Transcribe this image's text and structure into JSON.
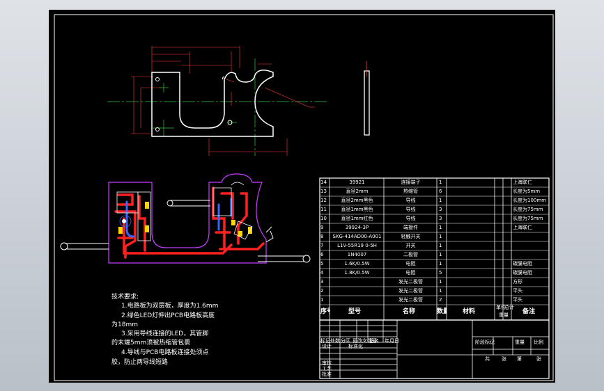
{
  "tech_notes": {
    "title": "技术要求:",
    "lines": [
      "1.电路板为双层板，厚度为1.6mm",
      "2.绿色LED灯伸出PCB电路板高度",
      "为18mm",
      "3.采用导线连接的LED，其管脚",
      "的末端5mm须被热缩管包裹",
      "4.导线与PCB电路板连接处须点",
      "胶，防止两导线短路"
    ]
  },
  "bom": {
    "header": {
      "seq": "序号",
      "code": "型号",
      "name": "名称",
      "qty": "数量",
      "material": "材料",
      "unit_weight": "单件",
      "total_weight": "总计",
      "weight": "重量",
      "remark": "备注"
    },
    "rows": [
      {
        "seq": "14",
        "code": "39921",
        "name": "连接端子",
        "qty": "1",
        "remark": "上海联仁"
      },
      {
        "seq": "13",
        "code": "直径2mm",
        "name": "热缩管",
        "qty": "6",
        "remark": "长度为5mm"
      },
      {
        "seq": "12",
        "code": "直径2mm黑色",
        "name": "导线",
        "qty": "1",
        "remark": "长度为100mm"
      },
      {
        "seq": "11",
        "code": "直径1mm黑色",
        "name": "导线",
        "qty": "3",
        "remark": "长度为75mm"
      },
      {
        "seq": "10",
        "code": "直径1mm红色",
        "name": "导线",
        "qty": "3",
        "remark": "长度为75mm"
      },
      {
        "seq": "9",
        "code": "39924-3P",
        "name": "端接件",
        "qty": "1",
        "remark": "上海联仁"
      },
      {
        "seq": "8",
        "code": "SKG-414AD00-A001",
        "name": "轻触开关",
        "qty": "1",
        "remark": ""
      },
      {
        "seq": "7",
        "code": "L1V-55R19 0-5H",
        "name": "开关",
        "qty": "1",
        "remark": ""
      },
      {
        "seq": "6",
        "code": "1N4007",
        "name": "二极管",
        "qty": "1",
        "remark": ""
      },
      {
        "seq": "5",
        "code": "1.6K/0.5W",
        "name": "电阻",
        "qty": "1",
        "remark": "碳膜电阻"
      },
      {
        "seq": "4",
        "code": "1.8K/0.5W",
        "name": "电阻",
        "qty": "5",
        "remark": "碳膜电阻"
      },
      {
        "seq": "3",
        "code": "",
        "name": "发光二极管",
        "qty": "1",
        "remark": "方形"
      },
      {
        "seq": "2",
        "code": "",
        "name": "发光二极管",
        "qty": "1",
        "remark": "平头"
      },
      {
        "seq": "1",
        "code": "",
        "name": "发光二极管",
        "qty": "2",
        "remark": "平头"
      }
    ]
  },
  "title_block": {
    "left_labels": [
      "标记",
      "处数",
      "分区",
      "更改文件号",
      "签名",
      "年月日"
    ],
    "role_labels": [
      "设计",
      "审核",
      "工艺",
      "批准"
    ],
    "standardization": "标准化",
    "stage_labels": [
      "阶段标记",
      "重量",
      "比例"
    ],
    "sheet_labels": [
      "共",
      "张",
      "第",
      "张"
    ]
  }
}
